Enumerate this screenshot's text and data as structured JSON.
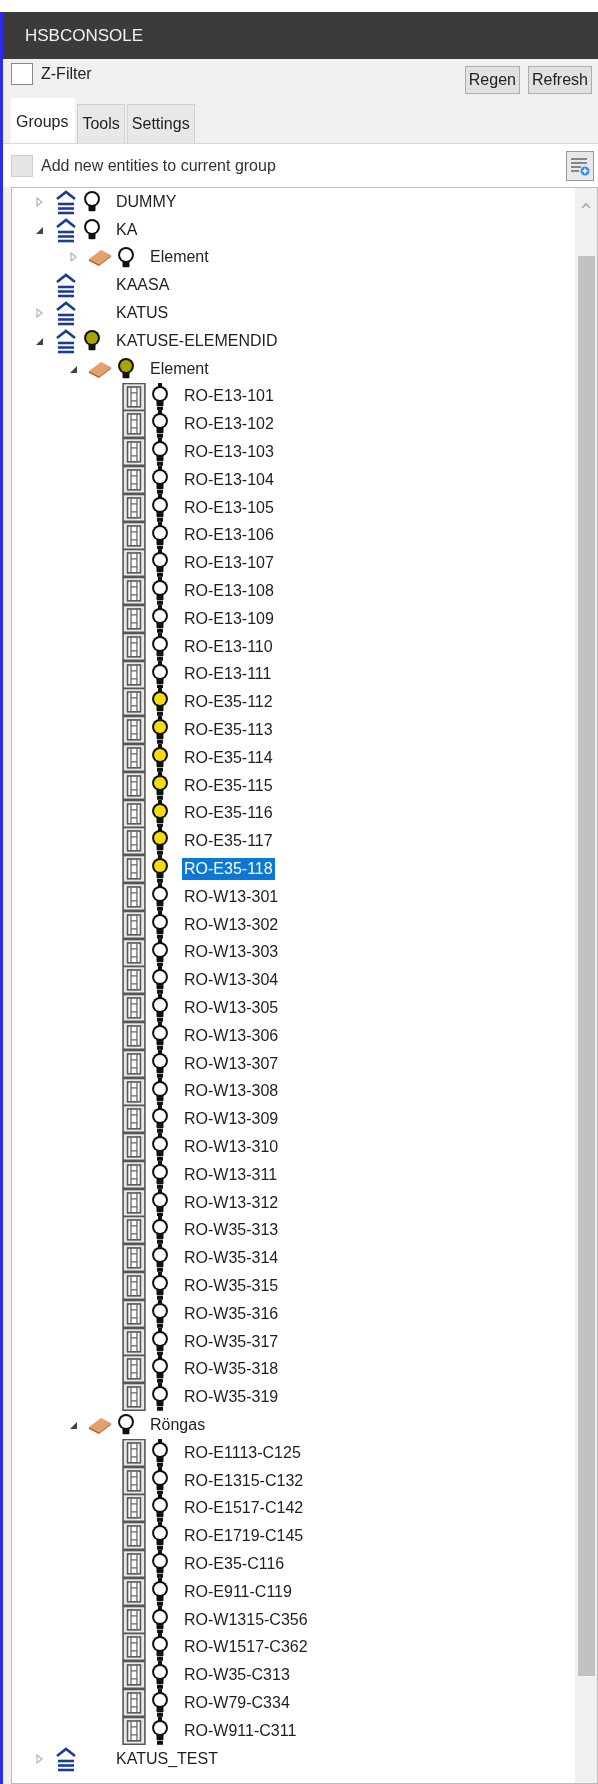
{
  "window": {
    "title": "HSBCONSOLE"
  },
  "z_filter": {
    "label": "Z-Filter",
    "checked": false
  },
  "buttons": [
    "Regen",
    "Refresh"
  ],
  "tabs": [
    {
      "label": "Groups",
      "selected": true
    },
    {
      "label": "Tools",
      "selected": false
    },
    {
      "label": "Settings",
      "selected": false
    }
  ],
  "add_to_group": {
    "label": "Add new entities to current group",
    "checked": false,
    "disabled": true
  },
  "tree": {
    "items": [
      {
        "kind": "group",
        "label": "DUMMY",
        "expanded": false,
        "color": "#ffffff",
        "selected": false
      },
      {
        "kind": "group",
        "label": "KA",
        "expanded": true,
        "color": "#ffffff",
        "selected": false,
        "children": [
          {
            "kind": "element",
            "label": "Element",
            "expanded": false,
            "color": "#ffffff",
            "selected": false
          }
        ]
      },
      {
        "kind": "group",
        "label": "KAASA",
        "selected": false
      },
      {
        "kind": "group",
        "label": "KATUS",
        "expanded": false,
        "selected": false
      },
      {
        "kind": "group",
        "label": "KATUSE-ELEMENDID",
        "expanded": true,
        "color": "#a8a400",
        "selected": false,
        "children": [
          {
            "kind": "element",
            "label": "Element",
            "expanded": true,
            "color": "#a8a400",
            "selected": false,
            "children": [
              {
                "kind": "item",
                "label": "RO-E13-101",
                "color": "#ffffff",
                "selected": false
              },
              {
                "kind": "item",
                "label": "RO-E13-102",
                "color": "#ffffff",
                "selected": false
              },
              {
                "kind": "item",
                "label": "RO-E13-103",
                "color": "#ffffff",
                "selected": false
              },
              {
                "kind": "item",
                "label": "RO-E13-104",
                "color": "#ffffff",
                "selected": false
              },
              {
                "kind": "item",
                "label": "RO-E13-105",
                "color": "#ffffff",
                "selected": false
              },
              {
                "kind": "item",
                "label": "RO-E13-106",
                "color": "#ffffff",
                "selected": false
              },
              {
                "kind": "item",
                "label": "RO-E13-107",
                "color": "#ffffff",
                "selected": false
              },
              {
                "kind": "item",
                "label": "RO-E13-108",
                "color": "#ffffff",
                "selected": false
              },
              {
                "kind": "item",
                "label": "RO-E13-109",
                "color": "#ffffff",
                "selected": false
              },
              {
                "kind": "item",
                "label": "RO-E13-110",
                "color": "#ffffff",
                "selected": false
              },
              {
                "kind": "item",
                "label": "RO-E13-111",
                "color": "#ffffff",
                "selected": false
              },
              {
                "kind": "item",
                "label": "RO-E35-112",
                "color": "#f6dc0c",
                "selected": false
              },
              {
                "kind": "item",
                "label": "RO-E35-113",
                "color": "#f6dc0c",
                "selected": false
              },
              {
                "kind": "item",
                "label": "RO-E35-114",
                "color": "#f6dc0c",
                "selected": false
              },
              {
                "kind": "item",
                "label": "RO-E35-115",
                "color": "#f6dc0c",
                "selected": false
              },
              {
                "kind": "item",
                "label": "RO-E35-116",
                "color": "#f6dc0c",
                "selected": false
              },
              {
                "kind": "item",
                "label": "RO-E35-117",
                "color": "#f6dc0c",
                "selected": false
              },
              {
                "kind": "item",
                "label": "RO-E35-118",
                "color": "#f6dc0c",
                "selected": true
              },
              {
                "kind": "item",
                "label": "RO-W13-301",
                "color": "#ffffff",
                "selected": false
              },
              {
                "kind": "item",
                "label": "RO-W13-302",
                "color": "#ffffff",
                "selected": false
              },
              {
                "kind": "item",
                "label": "RO-W13-303",
                "color": "#ffffff",
                "selected": false
              },
              {
                "kind": "item",
                "label": "RO-W13-304",
                "color": "#ffffff",
                "selected": false
              },
              {
                "kind": "item",
                "label": "RO-W13-305",
                "color": "#ffffff",
                "selected": false
              },
              {
                "kind": "item",
                "label": "RO-W13-306",
                "color": "#ffffff",
                "selected": false
              },
              {
                "kind": "item",
                "label": "RO-W13-307",
                "color": "#ffffff",
                "selected": false
              },
              {
                "kind": "item",
                "label": "RO-W13-308",
                "color": "#ffffff",
                "selected": false
              },
              {
                "kind": "item",
                "label": "RO-W13-309",
                "color": "#ffffff",
                "selected": false
              },
              {
                "kind": "item",
                "label": "RO-W13-310",
                "color": "#ffffff",
                "selected": false
              },
              {
                "kind": "item",
                "label": "RO-W13-311",
                "color": "#ffffff",
                "selected": false
              },
              {
                "kind": "item",
                "label": "RO-W13-312",
                "color": "#ffffff",
                "selected": false
              },
              {
                "kind": "item",
                "label": "RO-W35-313",
                "color": "#ffffff",
                "selected": false
              },
              {
                "kind": "item",
                "label": "RO-W35-314",
                "color": "#ffffff",
                "selected": false
              },
              {
                "kind": "item",
                "label": "RO-W35-315",
                "color": "#ffffff",
                "selected": false
              },
              {
                "kind": "item",
                "label": "RO-W35-316",
                "color": "#ffffff",
                "selected": false
              },
              {
                "kind": "item",
                "label": "RO-W35-317",
                "color": "#ffffff",
                "selected": false
              },
              {
                "kind": "item",
                "label": "RO-W35-318",
                "color": "#ffffff",
                "selected": false
              },
              {
                "kind": "item",
                "label": "RO-W35-319",
                "color": "#ffffff",
                "selected": false
              }
            ]
          },
          {
            "kind": "element",
            "label": "Röngas",
            "expanded": true,
            "color": "#ffffff",
            "selected": false,
            "children": [
              {
                "kind": "item",
                "label": "RO-E1113-C125",
                "color": "#ffffff",
                "selected": false
              },
              {
                "kind": "item",
                "label": "RO-E1315-C132",
                "color": "#ffffff",
                "selected": false
              },
              {
                "kind": "item",
                "label": "RO-E1517-C142",
                "color": "#ffffff",
                "selected": false
              },
              {
                "kind": "item",
                "label": "RO-E1719-C145",
                "color": "#ffffff",
                "selected": false
              },
              {
                "kind": "item",
                "label": "RO-E35-C116",
                "color": "#ffffff",
                "selected": false
              },
              {
                "kind": "item",
                "label": "RO-E911-C119",
                "color": "#ffffff",
                "selected": false
              },
              {
                "kind": "item",
                "label": "RO-W1315-C356",
                "color": "#ffffff",
                "selected": false
              },
              {
                "kind": "item",
                "label": "RO-W1517-C362",
                "color": "#ffffff",
                "selected": false
              },
              {
                "kind": "item",
                "label": "RO-W35-C313",
                "color": "#ffffff",
                "selected": false
              },
              {
                "kind": "item",
                "label": "RO-W79-C334",
                "color": "#ffffff",
                "selected": false
              },
              {
                "kind": "item",
                "label": "RO-W911-C311",
                "color": "#ffffff",
                "selected": false
              }
            ]
          }
        ]
      },
      {
        "kind": "group",
        "label": "KATUS_TEST",
        "expanded": false,
        "selected": false
      }
    ]
  }
}
